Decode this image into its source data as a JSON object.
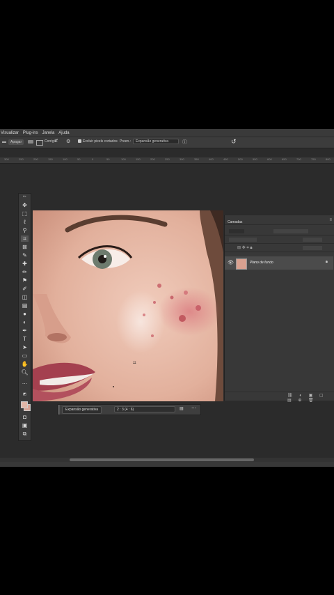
{
  "menu": [
    "Visualizar",
    "Plug-ins",
    "Janela",
    "Ajuda"
  ],
  "options": {
    "clear_button": "Apagar",
    "straighten_label": "Corrigir",
    "delete_cropped_label": "Excluir pixels cortados",
    "fill_label": "Preen.:",
    "fill_value": "Expansão generativa"
  },
  "ruler_ticks": [
    "300",
    "250",
    "200",
    "150",
    "100",
    "50",
    "0",
    "50",
    "100",
    "150",
    "200",
    "250",
    "300",
    "350",
    "400",
    "450",
    "500",
    "550",
    "600",
    "650",
    "700",
    "750",
    "800",
    "850",
    "900",
    "950",
    "1000"
  ],
  "layers_panel": {
    "tab": "Camadas",
    "layer_name": "Plano de fundo"
  },
  "context_bar": {
    "generate_label": "Expansão generativa",
    "ratio_value": "2 : 3 (4 : 6)"
  }
}
